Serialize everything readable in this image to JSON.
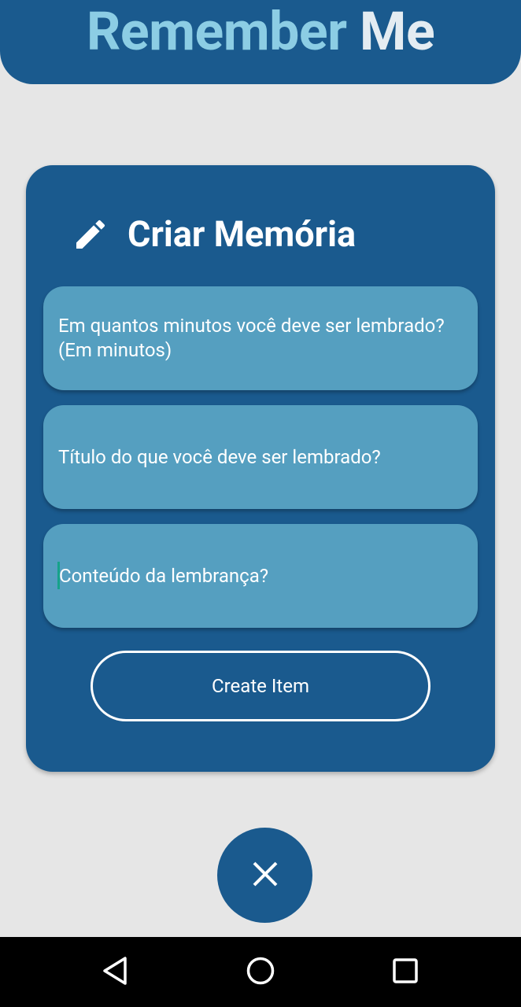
{
  "header": {
    "title_part1": "Remember",
    "title_part2": "Me"
  },
  "form": {
    "title": "Criar Memória",
    "title_icon": "pencil-icon",
    "fields": [
      {
        "placeholder": "Em quantos minutos você deve ser lembrado? (Em minutos)",
        "value": ""
      },
      {
        "placeholder": "Título do que você deve ser lembrado?",
        "value": ""
      },
      {
        "placeholder": "Conteúdo da lembrança?",
        "value": "",
        "focused": true
      }
    ],
    "submit_label": "Create Item"
  },
  "fab": {
    "icon": "close-icon"
  },
  "navbar": {
    "back_icon": "back-triangle-icon",
    "home_icon": "home-circle-icon",
    "recent_icon": "recent-apps-square-icon"
  },
  "colors": {
    "primary": "#1a5a8e",
    "field_bg": "#559fc0",
    "title_accent": "#8ccde4",
    "background": "#e6e6e6",
    "cursor": "#15a38a"
  }
}
